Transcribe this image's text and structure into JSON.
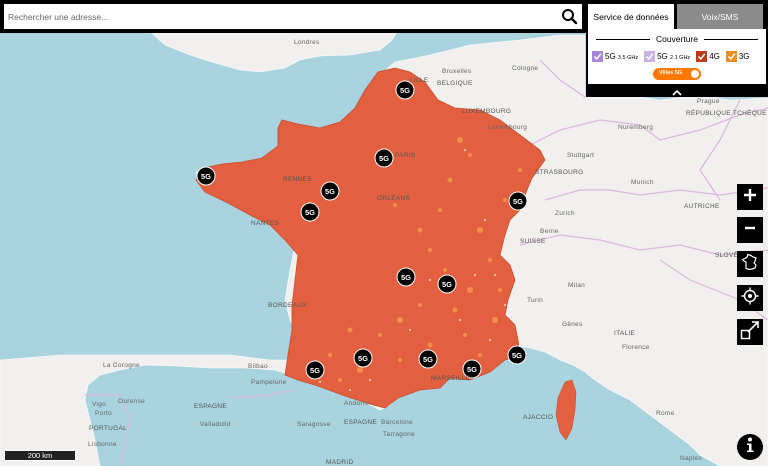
{
  "search": {
    "placeholder": "Rechercher une adresse..."
  },
  "tabs": {
    "data": "Service de données",
    "voice": "Voix/SMS"
  },
  "coverage": {
    "title": "Couverture",
    "items": [
      {
        "label": "5G",
        "sub": "3.5 GHz",
        "color": "#a885d8"
      },
      {
        "label": "5G",
        "sub": "2.1 GHz",
        "color": "#c9b3e6"
      },
      {
        "label": "4G",
        "sub": "",
        "color": "#c0391b"
      },
      {
        "label": "3G",
        "sub": "",
        "color": "#f28c1e"
      }
    ],
    "toggle_label": "Villes 5G"
  },
  "scale_label": "200 km",
  "marker_label": "5G",
  "colors": {
    "coverage": "#e2603f",
    "sea": "#a9d3de",
    "land": "#f2f0ee",
    "accent": "#ff7900"
  },
  "icons": [
    "search-icon",
    "chevron-up-icon",
    "plus-icon",
    "minus-icon",
    "france-icon",
    "locate-icon",
    "fullscreen-icon",
    "info-icon"
  ],
  "map_labels": {
    "londres": "Londres",
    "lille": "LILLE",
    "bruxelles": "Bruxelles",
    "belgique": "BELGIQUE",
    "cologne": "Cologne",
    "luxembourg": "LUXEMBOURG",
    "luxembourg_city": "Luxembourg",
    "prague": "Prague",
    "republique_tcheque": "RÉPUBLIQUE TCHÈQUE",
    "nuremberg": "Nuremberg",
    "stuttgart": "Stuttgart",
    "strasbourg": "STRASBOURG",
    "munich": "Munich",
    "autriche": "AUTRICHE",
    "zurich": "Zurich",
    "suisse": "SUISSE",
    "berne": "Berne",
    "slovenie": "SLOVÉN",
    "milan": "Milan",
    "turin": "Turin",
    "genes": "Gênes",
    "italie": "ITALIE",
    "florence": "Florence",
    "rome": "Rome",
    "ajaccio": "AJACCIO",
    "naples": "Naples",
    "marseille": "MARSEILLE",
    "bordeaux": "BORDEAUX",
    "nantes": "NANTES",
    "rennes": "RENNES",
    "paris": "PARIS",
    "orleans": "ORLÉANS",
    "bilbao": "Bilbao",
    "la_corogne": "La Corogne",
    "vigo": "Vigo",
    "ourense": "Ourense",
    "pampelune": "Pampelune",
    "andorre": "Andorre",
    "espagne": "ESPAGNE",
    "espagne2": "ESPAGNE",
    "portugal": "PORTUGAL",
    "porto": "Porto",
    "valladolid": "Valladolid",
    "saragosse": "Saragosse",
    "barcelone": "Barcelone",
    "tarragone": "Tarragone",
    "lisbonne": "Lisbonne",
    "madrid": "MADRID"
  }
}
